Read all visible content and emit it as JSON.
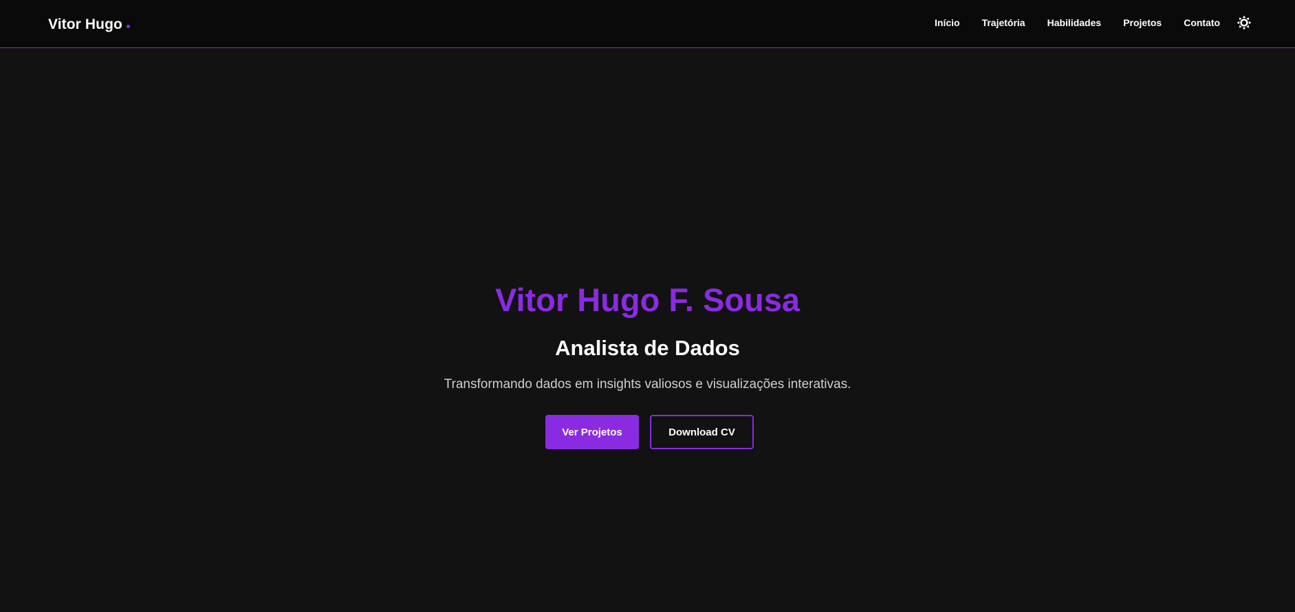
{
  "navbar": {
    "brand": "Vitor Hugo",
    "links": [
      "Início",
      "Trajetória",
      "Habilidades",
      "Projetos",
      "Contato"
    ],
    "theme_toggle_icon": "sun-icon"
  },
  "hero": {
    "title": "Vitor Hugo F. Sousa",
    "subtitle": "Analista de Dados",
    "tagline": "Transformando dados em insights valiosos e visualizações interativas.",
    "primary_button": "Ver Projetos",
    "secondary_button": "Download CV"
  },
  "colors": {
    "accent": "#8a2be2",
    "background": "#121212",
    "navbar_background": "#0a0a0b"
  }
}
